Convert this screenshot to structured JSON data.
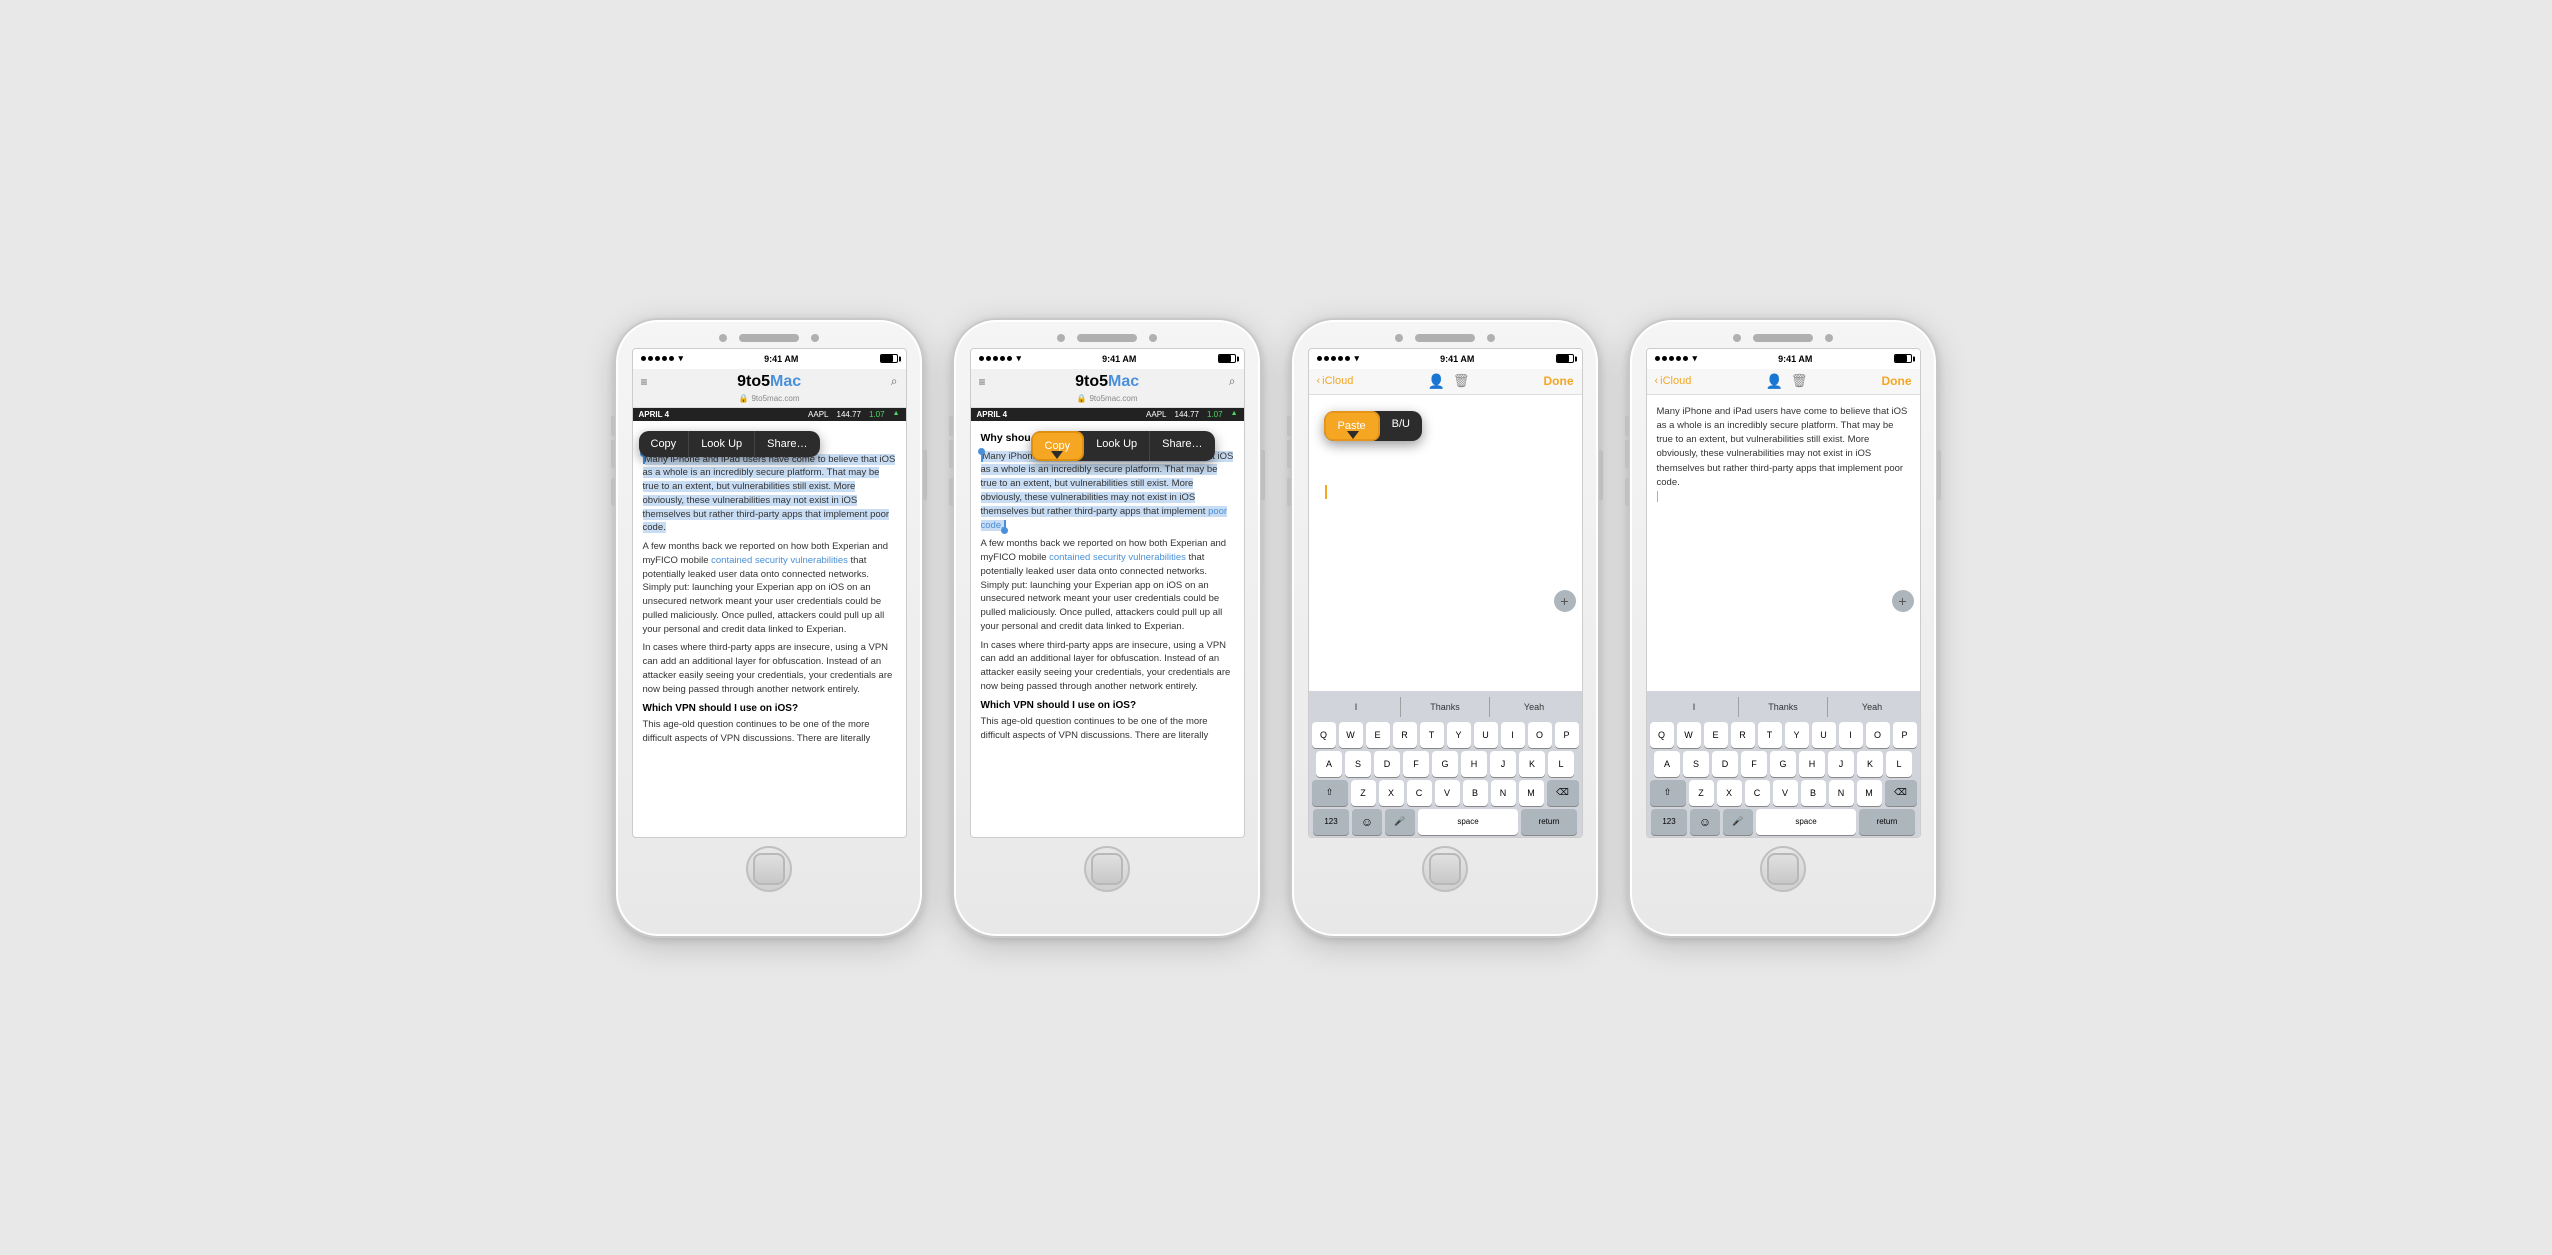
{
  "phones": [
    {
      "id": "phone1",
      "type": "safari",
      "status": {
        "signal": "•••••",
        "wifi": "wifi",
        "time": "9:41 AM",
        "battery": "full"
      },
      "browser": {
        "url": "9to5mac.com",
        "lock": "🔒",
        "menu_icon": "≡",
        "search_icon": "⌕",
        "title1": "9to5",
        "title2": "Mac"
      },
      "ticker": {
        "date": "APRIL 4",
        "symbol": "AAPL",
        "price": "144.77",
        "change": "1.07",
        "arrow": "▲"
      },
      "context_menu": {
        "items": [
          "Copy",
          "Look Up",
          "Share…"
        ],
        "highlighted": null
      },
      "article": {
        "text1": "Many iPhone and iPad users have come to believe that iOS as a whole is an incredibly secure platform. That may be true to an extent, but vulnerabilities still exist. More obviously, these vulnerabilities may not exist in iOS themselves but rather third-party apps that implement poor code.",
        "text2": "A few months back we reported on how both Experian and myFICO mobile",
        "link": "contained security vulnerabilities",
        "text3": "that potentially leaked user data onto connected networks. Simply put: launching your Experian app on iOS on an unsecured network meant your user credentials could be pulled maliciously. Once pulled, attackers could pull up all your personal and credit data linked to Experian.",
        "text4": "In cases where third-party apps are insecure, using a VPN can add an additional layer for obfuscation. Instead of an attacker easily seeing your credentials, your credentials are now being passed through another network entirely.",
        "heading": "Which VPN should I use on iOS?",
        "text5": "This age-old question continues to be one of the more difficult aspects of VPN discussions. There are literally"
      }
    },
    {
      "id": "phone2",
      "type": "safari",
      "status": {
        "signal": "•••••",
        "wifi": "wifi",
        "time": "9:41 AM",
        "battery": "full"
      },
      "browser": {
        "url": "9to5mac.com",
        "lock": "🔒",
        "menu_icon": "≡",
        "search_icon": "⌕",
        "title1": "9to5",
        "title2": "Mac"
      },
      "ticker": {
        "date": "APRIL 4",
        "symbol": "AAPL",
        "price": "144.77",
        "change": "1.07",
        "arrow": "▲"
      },
      "context_menu": {
        "items": [
          "Copy",
          "Look Up",
          "Share…"
        ],
        "highlighted": "Copy"
      },
      "article": {
        "subtitle": "Why shou",
        "text1": "Many iPhone and iPad users have come to believe that iOS as a whole is an incredibly secure platform. That may be true to an extent, but vulnerabilities still exist. More obviously, these vulnerabilities may not exist in iOS themselves but rather third-party apps that implement poor code.",
        "text2": "A few months back we reported on how both Experian and myFICO mobile",
        "link": "contained security vulnerabilities",
        "text3": "that potentially leaked user data onto connected networks. Simply put: launching your Experian app on iOS on an unsecured network meant your user credentials could be pulled maliciously. Once pulled, attackers could pull up all your personal and credit data linked to Experian.",
        "text4": "In cases where third-party apps are insecure, using a VPN can add an additional layer for obfuscation. Instead of an attacker easily seeing your credentials, your credentials are now being passed through another network entirely.",
        "heading": "Which VPN should I use on iOS?",
        "text5": "This age-old question continues to be one of the more difficult aspects of VPN discussions. There are literally"
      }
    },
    {
      "id": "phone3",
      "type": "notes",
      "status": {
        "signal": "•••••",
        "wifi": "wifi",
        "time": "9:41 AM",
        "battery": "full"
      },
      "notes": {
        "back_label": "iCloud",
        "done_label": "Done",
        "paste_menu": {
          "items": [
            "Paste",
            "B/U"
          ],
          "highlighted": "Paste"
        },
        "content": ""
      },
      "keyboard": {
        "suggestions": [
          "I",
          "Thanks",
          "Yeah"
        ],
        "rows": [
          [
            "Q",
            "W",
            "E",
            "R",
            "T",
            "Y",
            "U",
            "I",
            "O",
            "P"
          ],
          [
            "A",
            "S",
            "D",
            "F",
            "G",
            "H",
            "J",
            "K",
            "L"
          ],
          [
            "⇧",
            "Z",
            "X",
            "C",
            "V",
            "B",
            "N",
            "M",
            "⌫"
          ],
          [
            "123",
            "☺",
            "🎤",
            "space",
            "return"
          ]
        ]
      }
    },
    {
      "id": "phone4",
      "type": "notes",
      "status": {
        "signal": "•••••",
        "wifi": "wifi",
        "time": "9:41 AM",
        "battery": "full"
      },
      "notes": {
        "back_label": "iCloud",
        "done_label": "Done",
        "content": "Many iPhone and iPad users have come to believe that iOS as a whole is an incredibly secure platform. That may be true to an extent, but vulnerabilities still exist. More obviously, these vulnerabilities may not exist in iOS themselves but rather third-party apps that implement poor code."
      },
      "keyboard": {
        "suggestions": [
          "I",
          "Thanks",
          "Yeah"
        ],
        "rows": [
          [
            "Q",
            "W",
            "E",
            "R",
            "T",
            "Y",
            "U",
            "I",
            "O",
            "P"
          ],
          [
            "A",
            "S",
            "D",
            "F",
            "G",
            "H",
            "J",
            "K",
            "L"
          ],
          [
            "⇧",
            "Z",
            "X",
            "C",
            "V",
            "B",
            "N",
            "M",
            "⌫"
          ],
          [
            "123",
            "☺",
            "🎤",
            "space",
            "return"
          ]
        ]
      }
    }
  ]
}
